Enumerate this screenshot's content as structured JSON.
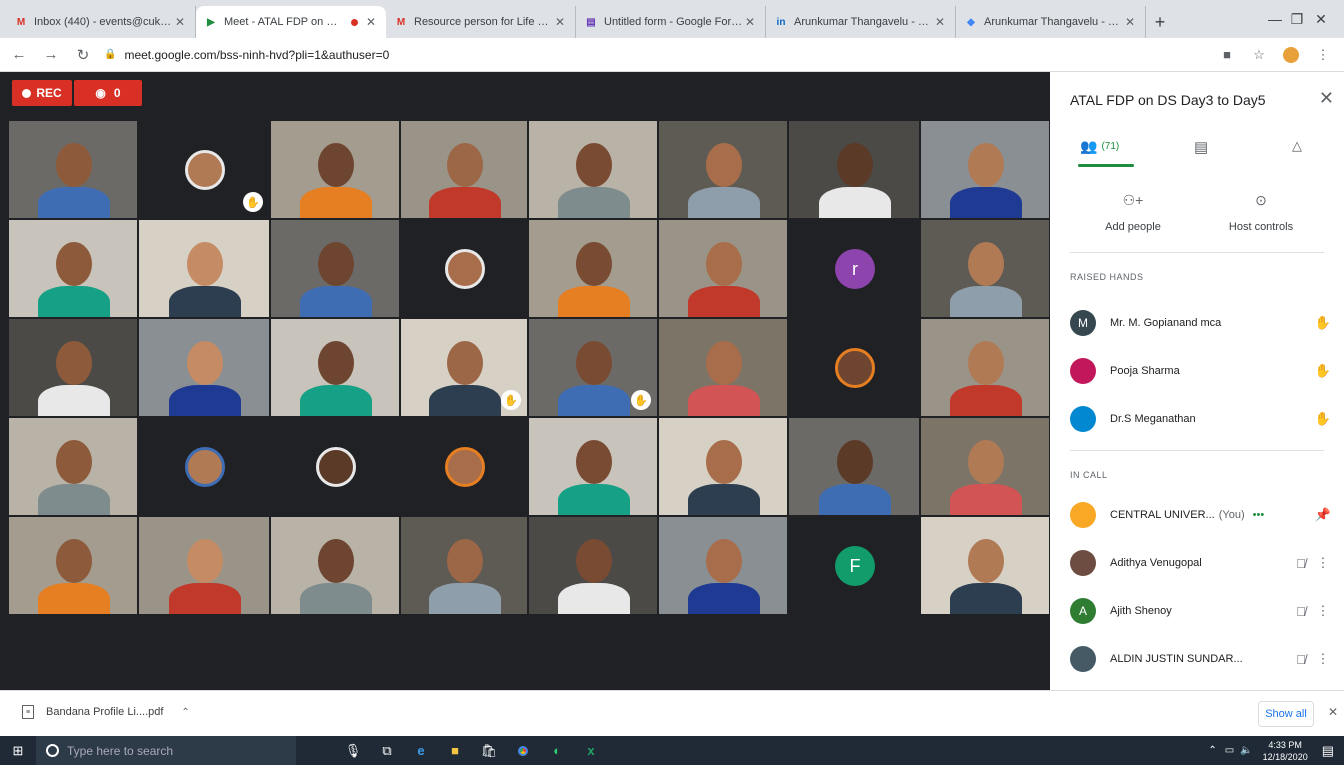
{
  "tabs": [
    {
      "label": "Inbox (440) - events@cukerala...",
      "favicon": "M",
      "fav_color": "#d93025",
      "active": false
    },
    {
      "label": "Meet - ATAL FDP on DS D...",
      "favicon": "▶",
      "fav_color": "#1e8e3e",
      "active": true,
      "recording": true
    },
    {
      "label": "Resource person for Life skill s...",
      "favicon": "M",
      "fav_color": "#d93025",
      "active": false
    },
    {
      "label": "Untitled form - Google Forms",
      "favicon": "▤",
      "fav_color": "#673ab7",
      "active": false
    },
    {
      "label": "Arunkumar Thangavelu - Seni...",
      "favicon": "in",
      "fav_color": "#0a66c2",
      "active": false
    },
    {
      "label": "Arunkumar Thangavelu - Goo...",
      "favicon": "◆",
      "fav_color": "#4285f4",
      "active": false
    }
  ],
  "window": {
    "minimize": "—",
    "maximize": "❐",
    "close": "✕"
  },
  "address": {
    "url": "meet.google.com/bss-ninh-hvd?pli=1&authuser=0"
  },
  "meeting": {
    "rec_label": "REC",
    "viewer_count": "0"
  },
  "tiles": [
    {
      "kind": "video"
    },
    {
      "kind": "avatar"
    },
    {
      "kind": "video"
    },
    {
      "kind": "video"
    },
    {
      "kind": "video"
    },
    {
      "kind": "video"
    },
    {
      "kind": "video"
    },
    {
      "kind": "video"
    },
    {
      "kind": "video"
    },
    {
      "kind": "video"
    },
    {
      "kind": "video"
    },
    {
      "kind": "avatar"
    },
    {
      "kind": "video"
    },
    {
      "kind": "video"
    },
    {
      "kind": "letter",
      "letter": "r",
      "color": "#8e44ad"
    },
    {
      "kind": "video"
    },
    {
      "kind": "video"
    },
    {
      "kind": "video"
    },
    {
      "kind": "video"
    },
    {
      "kind": "video"
    },
    {
      "kind": "video"
    },
    {
      "kind": "video"
    },
    {
      "kind": "avatar"
    },
    {
      "kind": "video"
    },
    {
      "kind": "video"
    },
    {
      "kind": "avatar"
    },
    {
      "kind": "avatar"
    },
    {
      "kind": "avatar"
    },
    {
      "kind": "video"
    },
    {
      "kind": "video"
    },
    {
      "kind": "video"
    },
    {
      "kind": "video"
    },
    {
      "kind": "video"
    },
    {
      "kind": "video"
    },
    {
      "kind": "video"
    },
    {
      "kind": "video"
    },
    {
      "kind": "video"
    },
    {
      "kind": "video"
    },
    {
      "kind": "letter",
      "letter": "F",
      "color": "#129c6b"
    },
    {
      "kind": "video"
    }
  ],
  "sidebar": {
    "title": "ATAL FDP on DS Day3 to Day5",
    "people_count": "(71)",
    "add_people": "Add people",
    "host_controls": "Host controls",
    "raised_hands_header": "RAISED HANDS",
    "raised_hands": [
      {
        "name": "Mr. M. Gopianand mca",
        "initial": "M",
        "color": "#37474f"
      },
      {
        "name": "Pooja Sharma",
        "initial": "",
        "color": "#c2185b"
      },
      {
        "name": "Dr.S Meganathan",
        "initial": "",
        "color": "#0288d1"
      }
    ],
    "in_call_header": "IN CALL",
    "in_call": [
      {
        "name": "CENTRAL UNIVER...",
        "suffix": "(You)",
        "initial": "",
        "color": "#f9a825",
        "extra": "•••"
      },
      {
        "name": "Adithya Venugopal",
        "initial": "",
        "color": "#6d4c41"
      },
      {
        "name": "Ajith Shenoy",
        "initial": "A",
        "color": "#2e7d32"
      },
      {
        "name": "ALDIN JUSTIN SUNDAR...",
        "initial": "",
        "color": "#455a64"
      }
    ]
  },
  "download": {
    "file": "Bandana Profile Li....pdf",
    "show_all": "Show all"
  },
  "taskbar": {
    "search_placeholder": "Type here to search",
    "time": "4:33 PM",
    "date": "12/18/2020"
  }
}
